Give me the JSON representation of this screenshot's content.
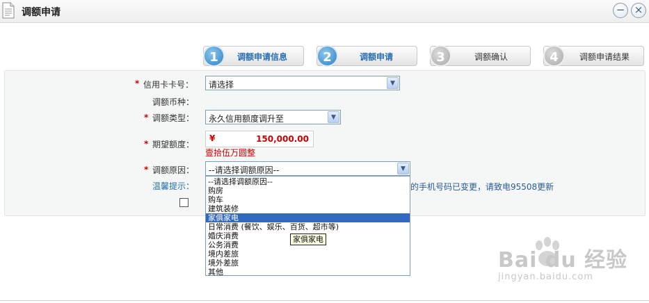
{
  "window": {
    "title": "调额申请",
    "min_symbol": "−",
    "close_symbol": "×"
  },
  "steps": [
    {
      "number": "1",
      "label": "调额申请信息",
      "state": "active"
    },
    {
      "number": "2",
      "label": "调额申请",
      "state": "active"
    },
    {
      "number": "3",
      "label": "调额确认",
      "state": "inactive"
    },
    {
      "number": "4",
      "label": "调额申请结果",
      "state": "inactive"
    }
  ],
  "form": {
    "required_mark": "*",
    "card_number": {
      "label": "信用卡卡号：",
      "value": "请选择"
    },
    "currency": {
      "label": "调额币种："
    },
    "adjust_type": {
      "label": "调额类型：",
      "value": "永久信用额度调升至"
    },
    "expected_amount": {
      "label": "期望额度：",
      "currency_symbol": "¥",
      "value": "150,000.00",
      "in_words": "壹拾伍万圆整"
    },
    "reason": {
      "label": "调额原因：",
      "value": "--请选择调额原因--"
    },
    "tip": {
      "label": "温馨提示：",
      "text": "的手机号码已变更，请致电95508更新"
    }
  },
  "reason_options": [
    {
      "label": "--请选择调额原因--",
      "selected": false
    },
    {
      "label": "购房",
      "selected": false
    },
    {
      "label": "购车",
      "selected": false
    },
    {
      "label": "建筑装修",
      "selected": false
    },
    {
      "label": "家俱家电",
      "selected": true
    },
    {
      "label": "日常消费 (餐饮、娱乐、百货、超市等)",
      "selected": false
    },
    {
      "label": "婚庆消费",
      "selected": false
    },
    {
      "label": "公务消费",
      "selected": false
    },
    {
      "label": "境内差旅",
      "selected": false
    },
    {
      "label": "境外差旅",
      "selected": false
    },
    {
      "label": "其他",
      "selected": false
    }
  ],
  "tooltip": "家俱家电",
  "watermark": {
    "brand": "Bai du 经验",
    "url": "jingyan.baidu.com"
  }
}
